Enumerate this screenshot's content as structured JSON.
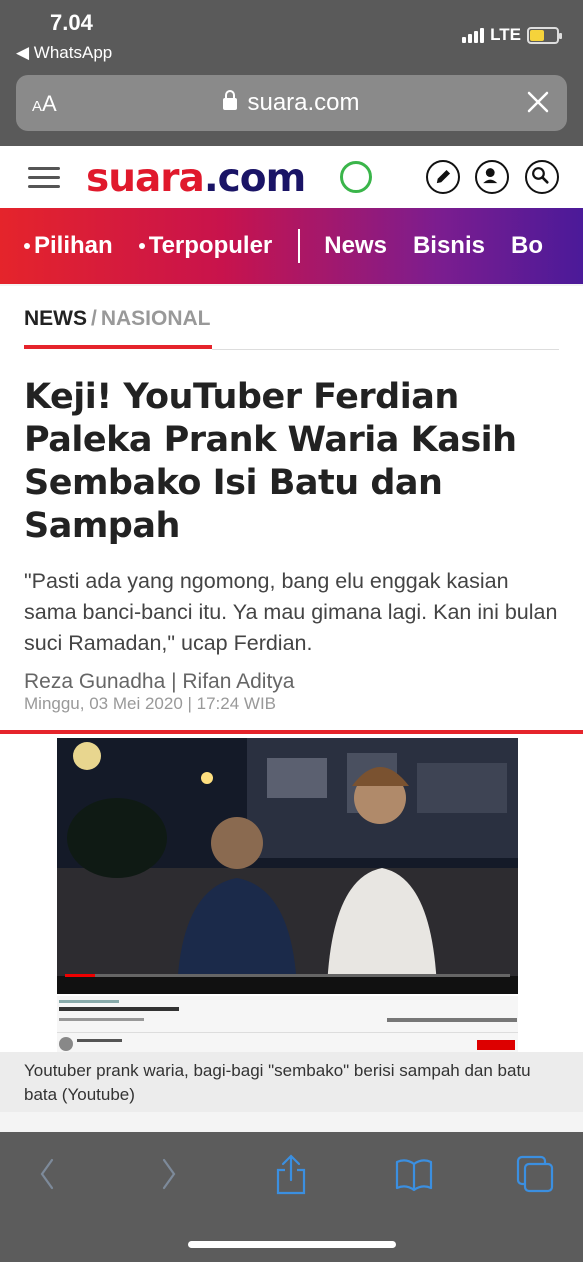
{
  "status_bar": {
    "time": "7.04",
    "back_app": "◀ WhatsApp",
    "network": "LTE",
    "battery_level": 0.55
  },
  "browser": {
    "text_size_label": "AA",
    "url": "suara.com",
    "nav_back_icon": "chevron-left-icon",
    "nav_forward_icon": "chevron-right-icon",
    "share_icon": "share-icon",
    "bookmarks_icon": "book-icon",
    "tabs_icon": "tabs-icon"
  },
  "site": {
    "logo_part1": "suara",
    "logo_part2": ".com",
    "brand_red": "#e0192c",
    "brand_navy": "#1a1466"
  },
  "nav": {
    "items": [
      {
        "label": "Pilihan",
        "dot": true
      },
      {
        "label": "Terpopuler",
        "dot": true
      },
      {
        "label": "News",
        "dot": false
      },
      {
        "label": "Bisnis",
        "dot": false
      },
      {
        "label": "Bo",
        "dot": false
      }
    ]
  },
  "article": {
    "breadcrumb_section": "NEWS",
    "breadcrumb_sep": "/",
    "breadcrumb_category": "NASIONAL",
    "headline": "Keji! YouTuber Ferdian Paleka Prank Waria Kasih Sembako Isi Batu dan Sampah",
    "lede": "\"Pasti ada yang ngomong, bang elu enggak kasian sama banci-banci itu. Ya mau gimana lagi. Kan ini bulan suci Ramadan,\" ucap Ferdian.",
    "authors": "Reza Gunadha | Rifan Aditya",
    "dateline": "Minggu, 03 Mei 2020 | 17:24 WIB"
  },
  "media": {
    "caption": "Youtuber prank waria, bagi-bagi \"sembako\" berisi sampah dan batu bata (Youtube)"
  }
}
